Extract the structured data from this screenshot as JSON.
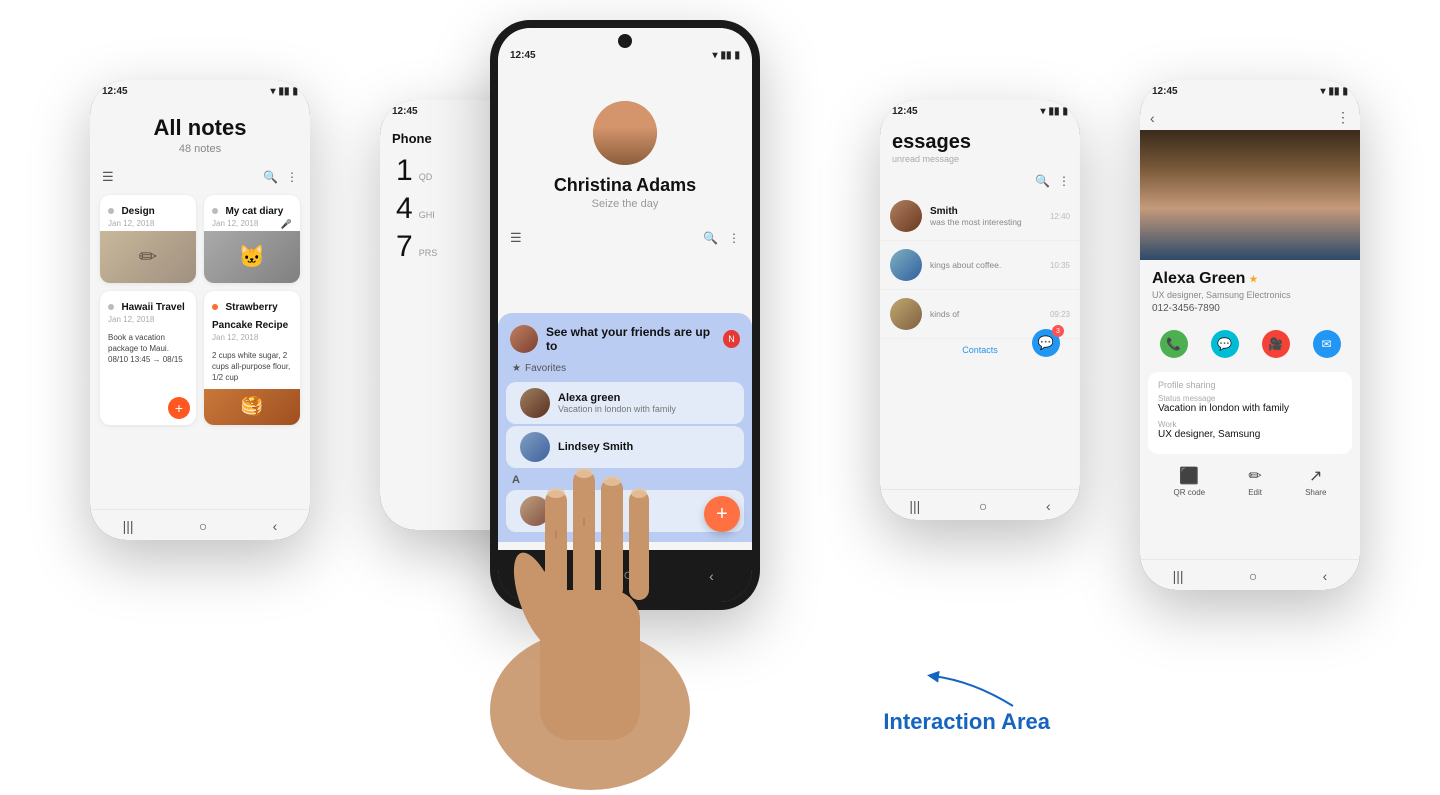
{
  "page": {
    "bg": "#ffffff"
  },
  "left_phone": {
    "status_time": "12:45",
    "title": "All notes",
    "subtitle": "48 notes",
    "notes": [
      {
        "id": "design",
        "title": "Design",
        "date": "Jan 12, 2018",
        "has_star": false,
        "has_dot": false,
        "img_color": "#d4c0a8"
      },
      {
        "id": "cat_diary",
        "title": "My cat diary",
        "date": "Jan 12, 2018",
        "has_star": false,
        "has_dot": false,
        "img_color": "#b0b0a0"
      },
      {
        "id": "hawaii",
        "title": "Hawaii Travel",
        "date": "Jan 12, 2018",
        "text": "Book a vacation package\nto Maui.\n08/10 13:45 → 08/15",
        "has_star": false,
        "has_dot": true,
        "dot_color": "#888"
      },
      {
        "id": "pancake",
        "title": "Strawberry Pancake Recipe",
        "date": "Jan 12, 2018",
        "text": "2 cups white sugar,\n2 cups all-purpose\nflour, 1/2 cup",
        "has_star": false,
        "has_dot": true,
        "dot_color": "#ff6b35",
        "img_color": "#c8783a"
      }
    ]
  },
  "mid_left_phone": {
    "status_time": "12:45",
    "app_title": "Phone",
    "numbers": [
      {
        "digit": "1",
        "letters": "",
        "sub": "QD"
      },
      {
        "digit": "4",
        "letters": "",
        "sub": "GHI"
      },
      {
        "digit": "7",
        "letters": "",
        "sub": "PRS"
      }
    ]
  },
  "center_phone": {
    "status_time": "12:45",
    "contact_name": "Christina  Adams",
    "contact_status": "Seize the day",
    "social_popup": {
      "header_text": "See what your friends are up to",
      "notif_count": "N",
      "favorites_label": "Favorites",
      "contacts": [
        {
          "name": "Alexa green",
          "status": "Vacation in london with family",
          "avatar_class": "sca1"
        },
        {
          "name": "Lindsey Smith",
          "status": "",
          "avatar_class": "sca2"
        }
      ],
      "section_letter": "A"
    },
    "fab_label": "+",
    "nav": [
      "|||",
      "○",
      "<"
    ]
  },
  "right_mid_phone": {
    "status_time": "12:45",
    "title": "essages",
    "subtitle": "unread message",
    "messages": [
      {
        "sender": "Smith",
        "preview": "was the most interesting",
        "time": "12:40",
        "avatar_class": "mav1"
      },
      {
        "sender": "",
        "preview": "kings about coffee.",
        "time": "10:35",
        "avatar_class": "mav2"
      },
      {
        "sender": "",
        "preview": "kinds of",
        "time": "09:23",
        "avatar_class": "mav3"
      }
    ],
    "chat_count": "3",
    "contacts_btn": "Contacts"
  },
  "right_phone": {
    "status_time": "12:45",
    "contact_name": "Alexa Green",
    "star": "★",
    "role": "UX designer, Samsung Electronics",
    "phone": "012-3456-7890",
    "actions": [
      {
        "icon": "📞",
        "color_class": "ac-green",
        "label": ""
      },
      {
        "icon": "💬",
        "color_class": "ac-teal",
        "label": ""
      },
      {
        "icon": "🎥",
        "color_class": "ac-red",
        "label": ""
      },
      {
        "icon": "✉",
        "color_class": "ac-blue",
        "label": ""
      }
    ],
    "profile_sharing_label": "Profile sharing",
    "status_message_label": "Status message",
    "status_message_value": "Vacation in london with family",
    "work_label": "Work",
    "work_value": "UX designer, Samsung",
    "bottom_actions": [
      {
        "icon": "⬛",
        "label": "QR code"
      },
      {
        "icon": "✏",
        "label": "Edit"
      },
      {
        "icon": "↗",
        "label": "Share"
      }
    ],
    "nav": [
      "|||",
      "○",
      "<"
    ]
  },
  "interaction_area": {
    "label": "Interaction Area",
    "arrow": "↙"
  }
}
